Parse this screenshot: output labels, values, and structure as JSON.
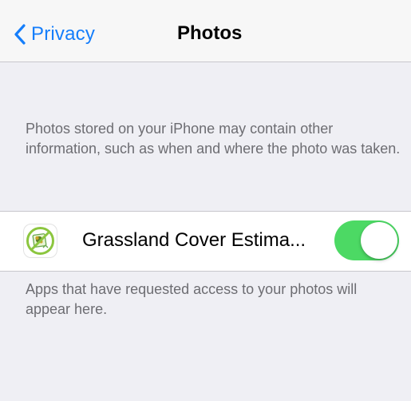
{
  "navbar": {
    "back_label": "Privacy",
    "title": "Photos",
    "back_icon": "chevron-left-icon",
    "accent_color": "#157efb"
  },
  "header_note": "Photos stored on your iPhone may contain other information, such as when and where the photo was taken.",
  "apps": [
    {
      "name": "Grassland Cover Estima...",
      "icon": "grassland-app-icon",
      "access_enabled": true,
      "toggle_color": "#4cd964"
    }
  ],
  "footer_note": "Apps that have requested access to your photos will appear here."
}
